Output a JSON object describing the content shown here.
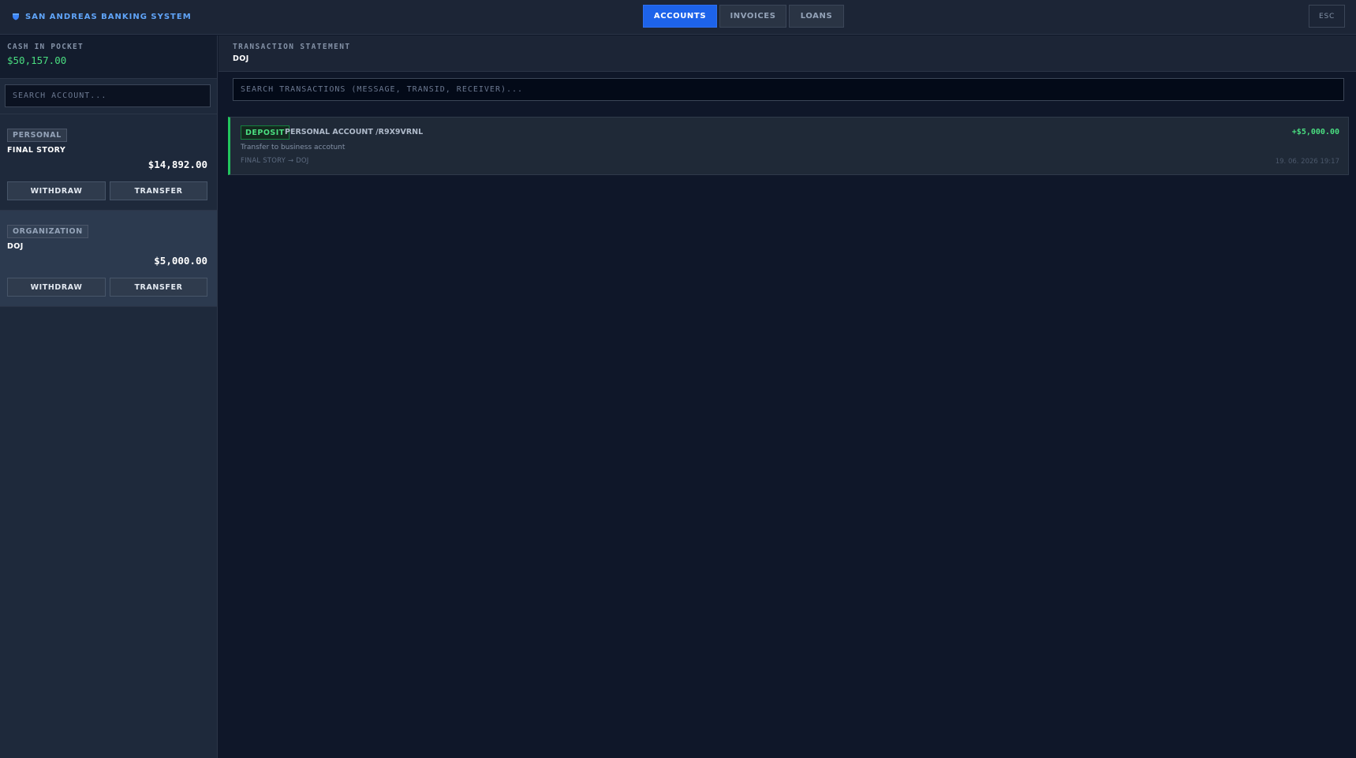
{
  "app": {
    "title": "SAN ANDREAS BANKING SYSTEM",
    "esc_label": "ESC"
  },
  "nav": {
    "tabs": [
      {
        "label": "ACCOUNTS",
        "active": true
      },
      {
        "label": "INVOICES",
        "active": false
      },
      {
        "label": "LOANS",
        "active": false
      }
    ]
  },
  "sidebar": {
    "cash_label": "CASH IN POCKET",
    "cash_value": "$50,157.00",
    "search_placeholder": "SEARCH ACCOUNT...",
    "accounts": [
      {
        "type": "PERSONAL",
        "name": "FINAL STORY",
        "balance": "$14,892.00",
        "withdraw_label": "WITHDRAW",
        "transfer_label": "TRANSFER",
        "selected": false
      },
      {
        "type": "ORGANIZATION",
        "name": "DOJ",
        "balance": "$5,000.00",
        "withdraw_label": "WITHDRAW",
        "transfer_label": "TRANSFER",
        "selected": true
      }
    ]
  },
  "statement": {
    "title": "TRANSACTION STATEMENT",
    "account": "DOJ",
    "search_placeholder": "SEARCH TRANSACTIONS (MESSAGE, TRANSID, RECEIVER)...",
    "transactions": [
      {
        "type": "DEPOSIT",
        "account": "PERSONAL ACCOUNT /R9X9VRNL",
        "amount": "+$5,000.00",
        "message": "Transfer to business accotunt",
        "meta": "FINAL STORY → DOJ",
        "date": "19. 06. 2026 19:17"
      }
    ]
  },
  "colors": {
    "accent": "#1d63ea",
    "positive": "#4ade80",
    "brand": "#60a5fa",
    "background": "#0f1729"
  },
  "icons": {
    "brand": "shield-icon"
  }
}
